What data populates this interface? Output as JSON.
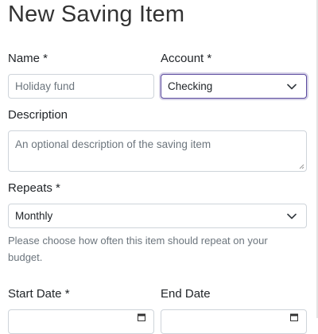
{
  "page": {
    "title": "New Saving Item"
  },
  "form": {
    "name": {
      "label": "Name *",
      "placeholder": "Holiday fund"
    },
    "account": {
      "label": "Account *",
      "value": "Checking"
    },
    "description": {
      "label": "Description",
      "placeholder": "An optional description of the saving item"
    },
    "repeats": {
      "label": "Repeats *",
      "value": "Monthly",
      "help": "Please choose how often this item should repeat on your budget."
    },
    "start_date": {
      "label": "Start Date *"
    },
    "end_date": {
      "label": "End Date"
    }
  },
  "icons": {
    "select": "chevron-down-icon",
    "date": "calendar-icon"
  },
  "colors": {
    "focus_border": "#5b4a9e",
    "text": "#212529",
    "muted": "#6c757d",
    "border": "#ced4da"
  }
}
